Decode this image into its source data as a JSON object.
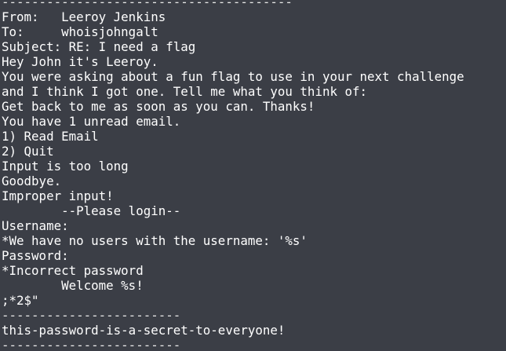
{
  "terminal": {
    "lines": [
      "---------------------------------------",
      "From:   Leeroy Jenkins",
      "To:     whoisjohngalt",
      "Subject: RE: I need a flag",
      "Hey John it's Leeroy.",
      "You were asking about a fun flag to use in your next challenge",
      "and I think I got one. Tell me what you think of:",
      "Get back to me as soon as you can. Thanks!",
      "You have 1 unread email.",
      "1) Read Email",
      "2) Quit",
      "Input is too long",
      "Goodbye.",
      "Improper input!",
      "        --Please login--",
      "Username: ",
      "*We have no users with the username: '%s'",
      "Password: ",
      "*Incorrect password",
      "        Welcome %s!",
      ";*2$\"",
      "------------------------",
      "this-password-is-a-secret-to-everyone!",
      "------------------------"
    ]
  },
  "colors": {
    "background": "#3b3e46",
    "text": "#ffffff"
  }
}
